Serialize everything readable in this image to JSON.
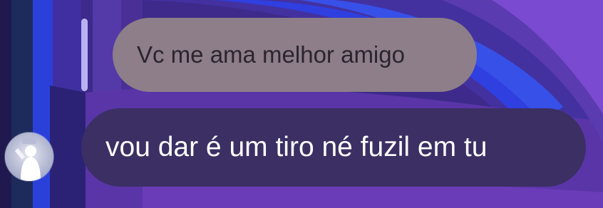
{
  "chat": {
    "quoted_message": {
      "text": "Vc me ama melhor amigo"
    },
    "reply_message": {
      "text": "vou dar é um tiro né fuzil em tu"
    },
    "sender": {
      "avatar_icon": "profile-photo-silhouette"
    }
  },
  "colors": {
    "quoted_bubble": "#8d7e89",
    "reply_bubble": "#3b2f63",
    "reply_bar": "#b9b2f2",
    "wallpaper_base": "#3d2a8a",
    "wallpaper_accent": "#2f3fe0"
  }
}
